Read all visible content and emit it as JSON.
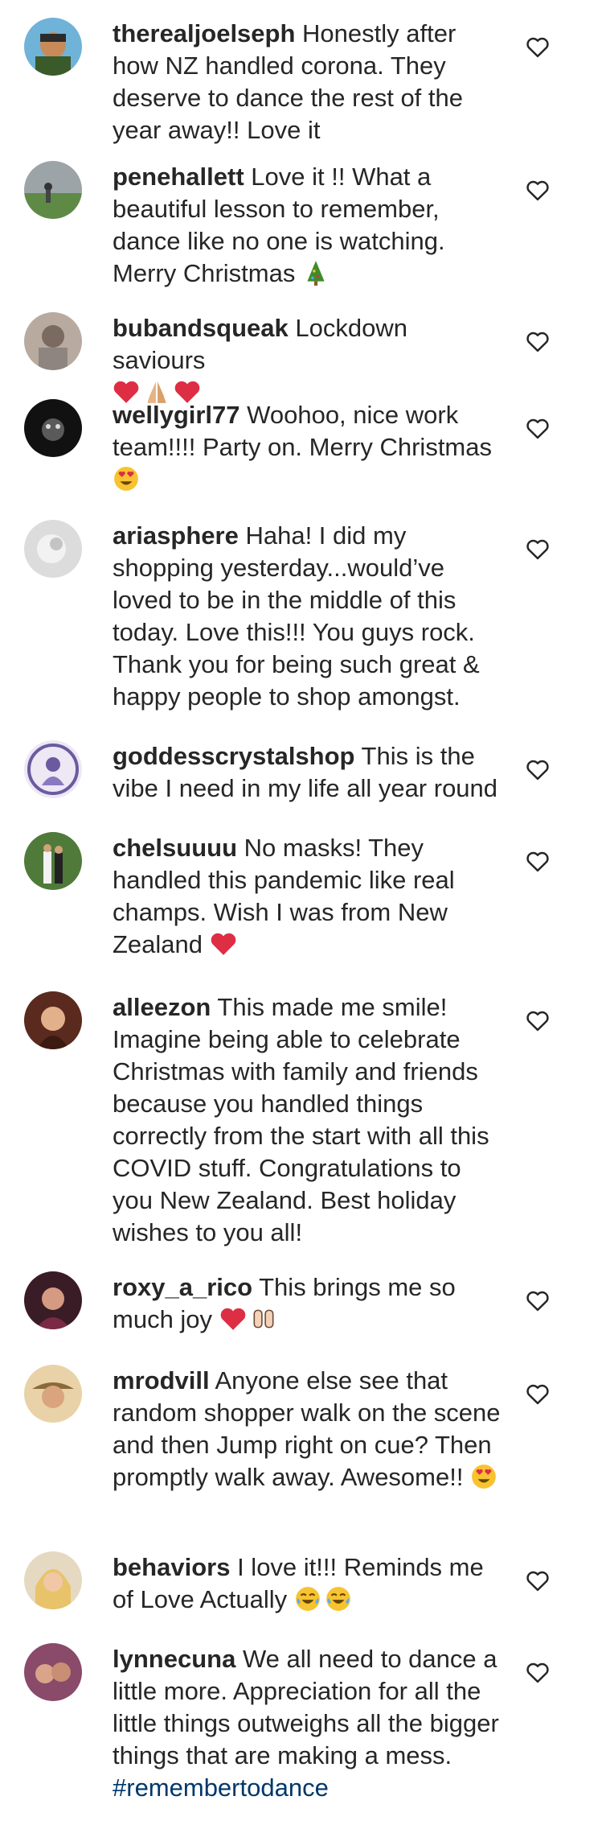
{
  "comments": [
    {
      "username": "therealjoelseph",
      "text": "Honestly after how NZ handled corona. They deserve to dance the rest of the year away!! Love it"
    },
    {
      "username": "penehallett",
      "text": "Love it !! What a beautiful lesson to remember, dance like no one is watching. Merry Christmas",
      "emojis": [
        "christmas-tree"
      ]
    },
    {
      "username": "bubandsqueak",
      "text": "Lockdown saviours",
      "emojis": [
        "red-heart",
        "folded-hands",
        "red-heart"
      ]
    },
    {
      "username": "wellygirl77",
      "text": "Woohoo, nice work team!!!! Party on. Merry Christmas",
      "emojis": [
        "heart-eyes"
      ]
    },
    {
      "username": "ariasphere",
      "text": "Haha! I did my shopping yesterday...would’ve loved to be in the middle of this today. Love this!!! You guys rock. Thank you for being such great & happy people to shop amongst."
    },
    {
      "username": "goddesscrystalshop",
      "text": "This is the vibe I need in my life all year round"
    },
    {
      "username": "chelsuuuu",
      "text": "No masks! They handled this pandemic like real champs. Wish I was from New Zealand",
      "emojis": [
        "red-heart"
      ]
    },
    {
      "username": "alleezon",
      "text": "This made me smile! Imagine being able to celebrate Christmas with family and friends because you handled things correctly from the start with all this COVID stuff. Congratulations to you New Zealand. Best holiday wishes to you all!"
    },
    {
      "username": "roxy_a_rico",
      "text": "This brings me so much joy",
      "emojis": [
        "red-heart",
        "raised-hands"
      ]
    },
    {
      "username": "mrodvill",
      "text": "Anyone else see that random shopper walk on the scene and then Jump right on cue? Then promptly walk away. Awesome!!",
      "emojis": [
        "heart-eyes"
      ]
    },
    {
      "username": "behaviors",
      "text": "I love it!!! Reminds me of Love Actually",
      "emojis": [
        "tears-of-joy",
        "tears-of-joy"
      ]
    },
    {
      "username": "lynnecuna",
      "text": "We all need to dance a little more. Appreciation for all the little things outweighs all the bigger things that are making a mess.",
      "hashtag": "#remembertodance"
    }
  ],
  "icons": {
    "like": "heart-outline-icon"
  },
  "colors": {
    "text": "#262626",
    "hashtag": "#00376b",
    "like_icon": "#262626",
    "heart_emoji": "#dd2e44"
  }
}
